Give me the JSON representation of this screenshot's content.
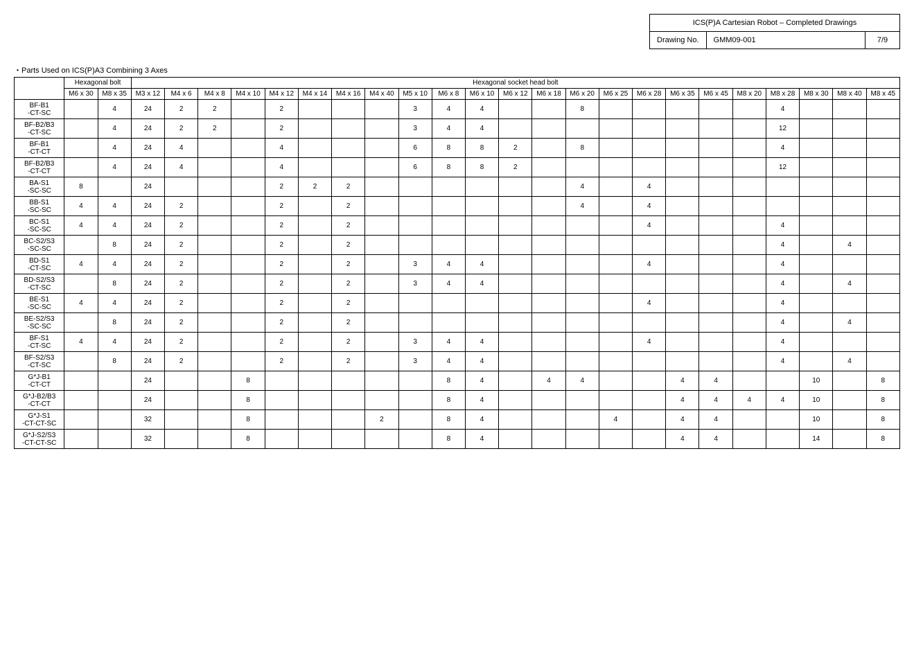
{
  "titleBox": {
    "title": "ICS(P)A Cartesian Robot – Completed Drawings",
    "drawingLabel": "Drawing No.",
    "drawingNo": "GMM09-001",
    "pageNo": "7/9"
  },
  "sectionTitle": "・Parts Used on ICS(P)A3 Combining 3 Axes",
  "groupHeaders": {
    "hexBolt": "Hexagonal bolt",
    "hexSocket": "Hexagonal socket head bolt"
  },
  "columns": [
    "M6 x 30",
    "M8 x 35",
    "M3 x 12",
    "M4 x 6",
    "M4 x 8",
    "M4 x 10",
    "M4 x 12",
    "M4 x 14",
    "M4 x 16",
    "M4 x 40",
    "M5 x 10",
    "M6 x 8",
    "M6 x 10",
    "M6 x 12",
    "M6 x 18",
    "M6 x 20",
    "M6 x 25",
    "M6 x 28",
    "M6 x 35",
    "M6 x 45",
    "M8 x 20",
    "M8 x 28",
    "M8 x 30",
    "M8 x 40",
    "M8 x 45"
  ],
  "rows": [
    {
      "label": "BF-B1\n-CT-SC",
      "cells": [
        "",
        "4",
        "24",
        "2",
        "2",
        "",
        "2",
        "",
        "",
        "",
        "3",
        "4",
        "4",
        "",
        "",
        "8",
        "",
        "",
        "",
        "",
        "",
        "4",
        "",
        "",
        ""
      ]
    },
    {
      "label": "BF-B2/B3\n-CT-SC",
      "cells": [
        "",
        "4",
        "24",
        "2",
        "2",
        "",
        "2",
        "",
        "",
        "",
        "3",
        "4",
        "4",
        "",
        "",
        "",
        "",
        "",
        "",
        "",
        "",
        "12",
        "",
        "",
        ""
      ]
    },
    {
      "label": "BF-B1\n-CT-CT",
      "cells": [
        "",
        "4",
        "24",
        "4",
        "",
        "",
        "4",
        "",
        "",
        "",
        "6",
        "8",
        "8",
        "2",
        "",
        "8",
        "",
        "",
        "",
        "",
        "",
        "4",
        "",
        "",
        ""
      ]
    },
    {
      "label": "BF-B2/B3\n-CT-CT",
      "cells": [
        "",
        "4",
        "24",
        "4",
        "",
        "",
        "4",
        "",
        "",
        "",
        "6",
        "8",
        "8",
        "2",
        "",
        "",
        "",
        "",
        "",
        "",
        "",
        "12",
        "",
        "",
        ""
      ]
    },
    {
      "label": "BA-S1\n-SC-SC",
      "cells": [
        "8",
        "",
        "24",
        "",
        "",
        "",
        "2",
        "2",
        "2",
        "",
        "",
        "",
        "",
        "",
        "",
        "4",
        "",
        "4",
        "",
        "",
        "",
        "",
        "",
        "",
        ""
      ]
    },
    {
      "label": "BB-S1\n-SC-SC",
      "cells": [
        "4",
        "4",
        "24",
        "2",
        "",
        "",
        "2",
        "",
        "2",
        "",
        "",
        "",
        "",
        "",
        "",
        "4",
        "",
        "4",
        "",
        "",
        "",
        "",
        "",
        "",
        ""
      ]
    },
    {
      "label": "BC-S1\n-SC-SC",
      "cells": [
        "4",
        "4",
        "24",
        "2",
        "",
        "",
        "2",
        "",
        "2",
        "",
        "",
        "",
        "",
        "",
        "",
        "",
        "",
        "4",
        "",
        "",
        "",
        "4",
        "",
        "",
        ""
      ]
    },
    {
      "label": "BC-S2/S3\n-SC-SC",
      "cells": [
        "",
        "8",
        "24",
        "2",
        "",
        "",
        "2",
        "",
        "2",
        "",
        "",
        "",
        "",
        "",
        "",
        "",
        "",
        "",
        "",
        "",
        "",
        "4",
        "",
        "4",
        ""
      ]
    },
    {
      "label": "BD-S1\n-CT-SC",
      "cells": [
        "4",
        "4",
        "24",
        "2",
        "",
        "",
        "2",
        "",
        "2",
        "",
        "3",
        "4",
        "4",
        "",
        "",
        "",
        "",
        "4",
        "",
        "",
        "",
        "4",
        "",
        "",
        ""
      ]
    },
    {
      "label": "BD-S2/S3\n-CT-SC",
      "cells": [
        "",
        "8",
        "24",
        "2",
        "",
        "",
        "2",
        "",
        "2",
        "",
        "3",
        "4",
        "4",
        "",
        "",
        "",
        "",
        "",
        "",
        "",
        "",
        "4",
        "",
        "4",
        ""
      ]
    },
    {
      "label": "BE-S1\n-SC-SC",
      "cells": [
        "4",
        "4",
        "24",
        "2",
        "",
        "",
        "2",
        "",
        "2",
        "",
        "",
        "",
        "",
        "",
        "",
        "",
        "",
        "4",
        "",
        "",
        "",
        "4",
        "",
        "",
        ""
      ]
    },
    {
      "label": "BE-S2/S3\n-SC-SC",
      "cells": [
        "",
        "8",
        "24",
        "2",
        "",
        "",
        "2",
        "",
        "2",
        "",
        "",
        "",
        "",
        "",
        "",
        "",
        "",
        "",
        "",
        "",
        "",
        "4",
        "",
        "4",
        ""
      ]
    },
    {
      "label": "BF-S1\n-CT-SC",
      "cells": [
        "4",
        "4",
        "24",
        "2",
        "",
        "",
        "2",
        "",
        "2",
        "",
        "3",
        "4",
        "4",
        "",
        "",
        "",
        "",
        "4",
        "",
        "",
        "",
        "4",
        "",
        "",
        ""
      ]
    },
    {
      "label": "BF-S2/S3\n-CT-SC",
      "cells": [
        "",
        "8",
        "24",
        "2",
        "",
        "",
        "2",
        "",
        "2",
        "",
        "3",
        "4",
        "4",
        "",
        "",
        "",
        "",
        "",
        "",
        "",
        "",
        "4",
        "",
        "4",
        ""
      ]
    },
    {
      "label": "G*J-B1\n-CT-CT",
      "cells": [
        "",
        "",
        "24",
        "",
        "",
        "8",
        "",
        "",
        "",
        "",
        "",
        "8",
        "4",
        "",
        "4",
        "4",
        "",
        "",
        "4",
        "4",
        "",
        "",
        "10",
        "",
        "8"
      ]
    },
    {
      "label": "G*J-B2/B3\n-CT-CT",
      "cells": [
        "",
        "",
        "24",
        "",
        "",
        "8",
        "",
        "",
        "",
        "",
        "",
        "8",
        "4",
        "",
        "",
        "",
        "",
        "",
        "4",
        "4",
        "4",
        "4",
        "10",
        "",
        "8"
      ]
    },
    {
      "label": "G*J-S1\n-CT-CT-SC",
      "cells": [
        "",
        "",
        "32",
        "",
        "",
        "8",
        "",
        "",
        "",
        "2",
        "",
        "8",
        "4",
        "",
        "",
        "",
        "4",
        "",
        "4",
        "4",
        "",
        "",
        "10",
        "",
        "8"
      ]
    },
    {
      "label": "G*J-S2/S3\n-CT-CT-SC",
      "cells": [
        "",
        "",
        "32",
        "",
        "",
        "8",
        "",
        "",
        "",
        "",
        "",
        "8",
        "4",
        "",
        "",
        "",
        "",
        "",
        "4",
        "4",
        "",
        "",
        "14",
        "",
        "8"
      ]
    }
  ]
}
